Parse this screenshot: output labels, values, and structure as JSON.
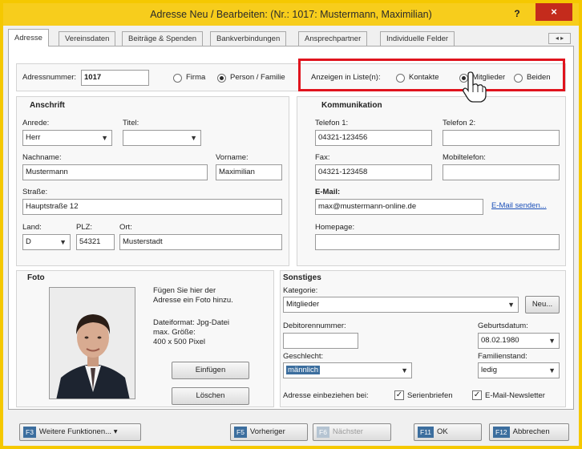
{
  "window": {
    "title": "Adresse Neu / Bearbeiten: (Nr.: 1017: Mustermann, Maximilian)",
    "help": "?",
    "close": "×"
  },
  "tabs": [
    {
      "label": "Adresse",
      "active": true
    },
    {
      "label": "Vereinsdaten"
    },
    {
      "label": "Beiträge & Spenden"
    },
    {
      "label": "Bankverbindungen"
    },
    {
      "label": "Ansprechpartner"
    },
    {
      "label": "Individuelle Felder"
    }
  ],
  "tabscroll": "◂ ▸",
  "top": {
    "adressnummer_label": "Adressnummer:",
    "adressnummer": "1017",
    "firma": "Firma",
    "person": "Person / Familie",
    "anzeigen_label": "Anzeigen in Liste(n):",
    "kontakte": "Kontakte",
    "mitglieder": "Mitglieder",
    "beiden": "Beiden"
  },
  "anschrift": {
    "heading": "Anschrift",
    "anrede_label": "Anrede:",
    "anrede": "Herr",
    "titel_label": "Titel:",
    "titel": "",
    "nachname_label": "Nachname:",
    "nachname": "Mustermann",
    "vorname_label": "Vorname:",
    "vorname": "Maximilian",
    "strasse_label": "Straße:",
    "strasse": "Hauptstraße 12",
    "land_label": "Land:",
    "land": "D",
    "plz_label": "PLZ:",
    "plz": "54321",
    "ort_label": "Ort:",
    "ort": "Musterstadt"
  },
  "kommunikation": {
    "heading": "Kommunikation",
    "telefon1_label": "Telefon 1:",
    "telefon1": "04321-123456",
    "telefon2_label": "Telefon 2:",
    "telefon2": "",
    "fax_label": "Fax:",
    "fax": "04321-123458",
    "mobil_label": "Mobiltelefon:",
    "mobil": "",
    "email_label": "E-Mail:",
    "email": "max@mustermann-online.de",
    "email_senden": "E-Mail senden...",
    "homepage_label": "Homepage:",
    "homepage": ""
  },
  "foto": {
    "heading": "Foto",
    "hint1": "Fügen Sie hier der",
    "hint2": "Adresse ein Foto hinzu.",
    "format1": "Dateiformat: Jpg-Datei",
    "format2": "max. Größe:",
    "format3": "400 x 500 Pixel",
    "einfuegen": "Einfügen",
    "loeschen": "Löschen"
  },
  "sonstiges": {
    "heading": "Sonstiges",
    "kategorie_label": "Kategorie:",
    "kategorie": "Mitglieder",
    "neu": "Neu...",
    "debitoren_label": "Debitorennummer:",
    "debitoren": "",
    "geburtsdatum_label": "Geburtsdatum:",
    "geburtsdatum": "08.02.1980",
    "geschlecht_label": "Geschlecht:",
    "geschlecht": "männlich",
    "familienstand_label": "Familienstand:",
    "familienstand": "ledig",
    "einbeziehen_label": "Adresse einbeziehen bei:",
    "serienbriefe": "Serienbriefen",
    "newsletter": "E-Mail-Newsletter"
  },
  "footer": {
    "f3": "F3",
    "weitere": "Weitere Funktionen...",
    "f5": "F5",
    "vorheriger": "Vorheriger",
    "f6": "F6",
    "naechster": "Nächster",
    "f11": "F11",
    "ok": "OK",
    "f12": "F12",
    "abbrechen": "Abbrechen"
  },
  "colors": {
    "title_bar": "#f7cd1c",
    "highlight": "#e0141e",
    "fkey": "#3c6e9e"
  }
}
